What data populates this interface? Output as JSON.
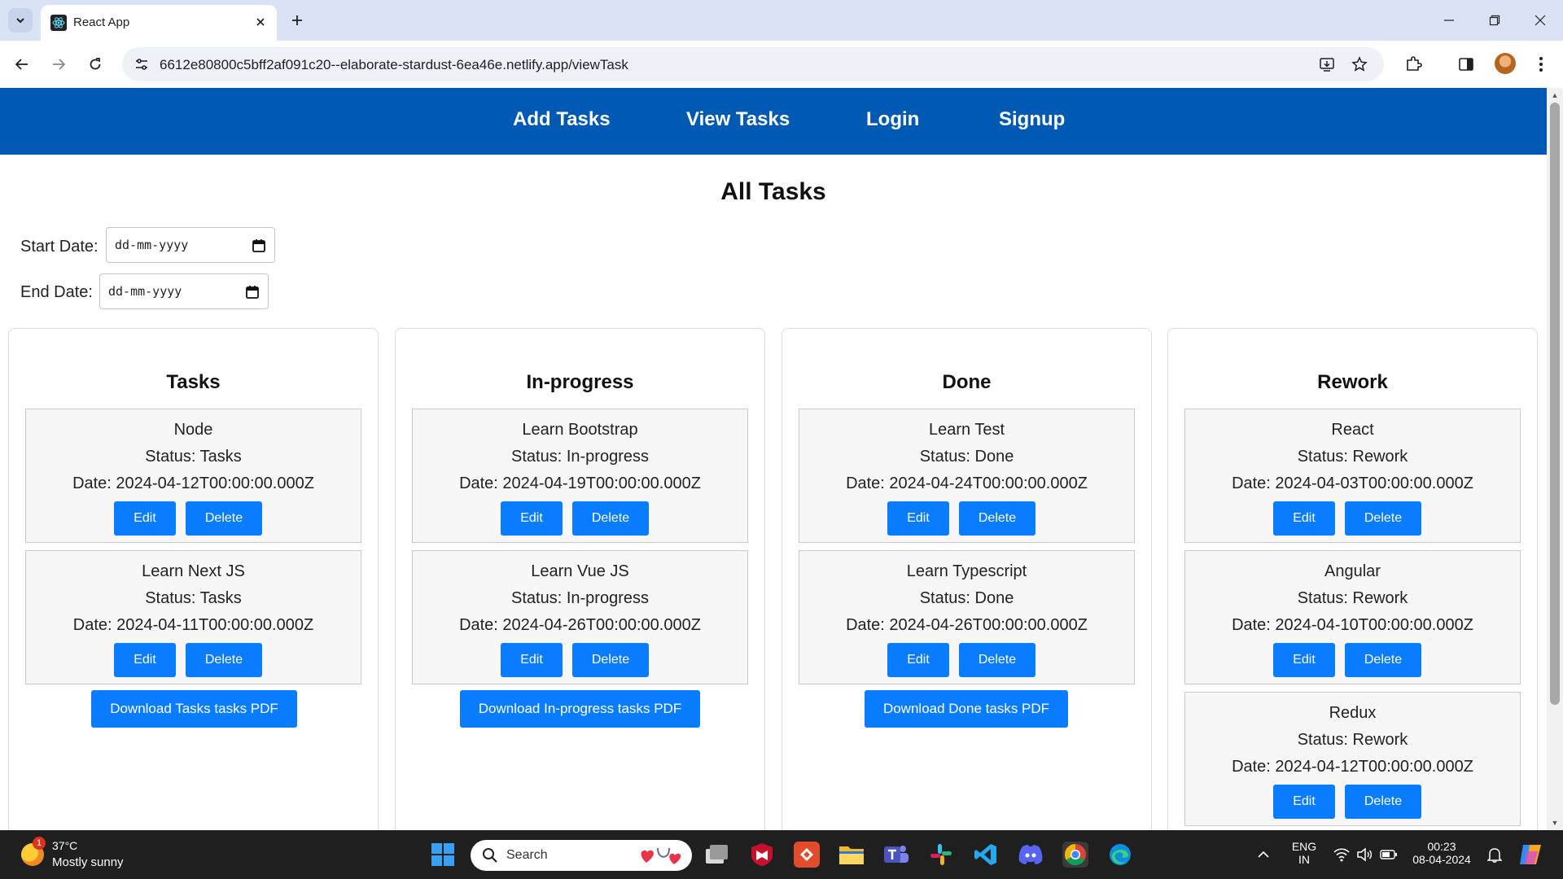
{
  "browser": {
    "tab_title": "React App",
    "url": "6612e80800c5bff2af091c20--elaborate-stardust-6ea46e.netlify.app/viewTask"
  },
  "appnav": {
    "links": [
      "Add Tasks",
      "View Tasks",
      "Login",
      "Signup"
    ]
  },
  "page": {
    "title": "All Tasks",
    "start_date_label": "Start Date:",
    "end_date_label": "End Date:",
    "date_placeholder": "dd-mm-yyyy"
  },
  "labels": {
    "edit": "Edit",
    "delete": "Delete"
  },
  "columns": [
    {
      "title": "Tasks",
      "cards": [
        {
          "name": "Node",
          "status": "Status: Tasks",
          "date": "Date: 2024-04-12T00:00:00.000Z"
        },
        {
          "name": "Learn Next JS",
          "status": "Status: Tasks",
          "date": "Date: 2024-04-11T00:00:00.000Z"
        }
      ],
      "download_label": "Download Tasks tasks PDF"
    },
    {
      "title": "In-progress",
      "cards": [
        {
          "name": "Learn Bootstrap",
          "status": "Status: In-progress",
          "date": "Date: 2024-04-19T00:00:00.000Z"
        },
        {
          "name": "Learn Vue JS",
          "status": "Status: In-progress",
          "date": "Date: 2024-04-26T00:00:00.000Z"
        }
      ],
      "download_label": "Download In-progress tasks PDF"
    },
    {
      "title": "Done",
      "cards": [
        {
          "name": "Learn Test",
          "status": "Status: Done",
          "date": "Date: 2024-04-24T00:00:00.000Z"
        },
        {
          "name": "Learn Typescript",
          "status": "Status: Done",
          "date": "Date: 2024-04-26T00:00:00.000Z"
        }
      ],
      "download_label": "Download Done tasks PDF"
    },
    {
      "title": "Rework",
      "cards": [
        {
          "name": "React",
          "status": "Status: Rework",
          "date": "Date: 2024-04-03T00:00:00.000Z"
        },
        {
          "name": "Angular",
          "status": "Status: Rework",
          "date": "Date: 2024-04-10T00:00:00.000Z"
        },
        {
          "name": "Redux",
          "status": "Status: Rework",
          "date": "Date: 2024-04-12T00:00:00.000Z"
        }
      ]
    }
  ],
  "taskbar": {
    "weather_temp": "37°C",
    "weather_desc": "Mostly sunny",
    "weather_badge": "1",
    "search_label": "Search",
    "lang_top": "ENG",
    "lang_bottom": "IN",
    "time": "00:23",
    "date": "08-04-2024"
  },
  "colors": {
    "nav_bg": "#0059b3",
    "button_bg": "#0a7cff",
    "tabbar_bg": "#dae3f5",
    "taskbar_bg": "#1f1f1f"
  }
}
